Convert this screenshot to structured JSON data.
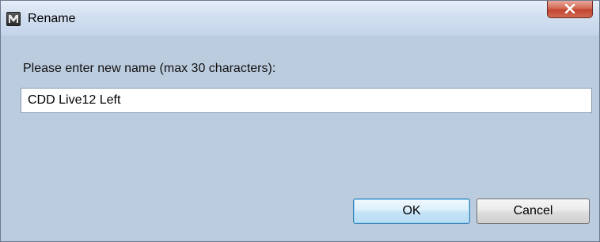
{
  "window": {
    "title": "Rename",
    "app_icon": "app-logo-icon",
    "close_icon": "close-icon"
  },
  "dialog": {
    "prompt": "Please enter new name (max 30 characters):",
    "input_value": "CDD Live12 Left",
    "ok_label": "OK",
    "cancel_label": "Cancel"
  },
  "colors": {
    "dialog_background": "#bcccdf",
    "close_button": "#c2452f",
    "default_button_border": "#3c7fb1"
  }
}
